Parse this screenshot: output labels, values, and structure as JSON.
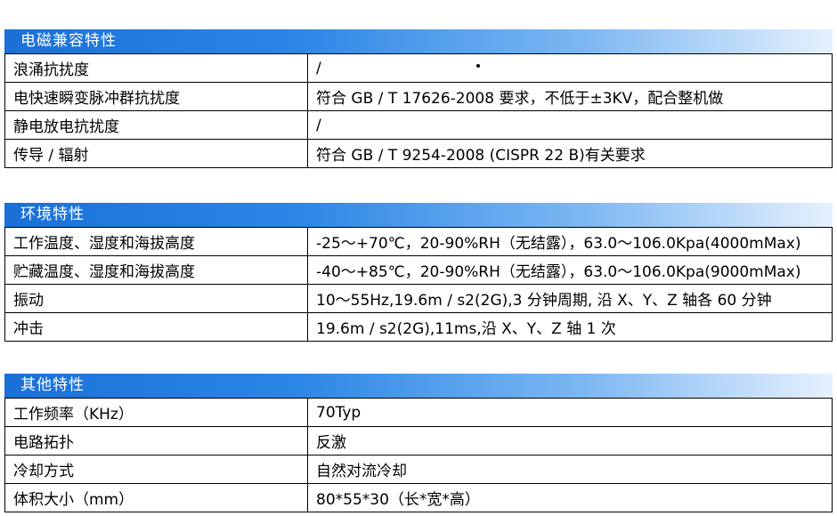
{
  "sections": [
    {
      "title": "电磁兼容特性",
      "rows": [
        {
          "label": "浪涌抗扰度",
          "value": "/"
        },
        {
          "label": "电快速瞬变脉冲群抗扰度",
          "value": "符合 GB / T 17626-2008 要求，不低于±3KV，配合整机做"
        },
        {
          "label": "静电放电抗扰度",
          "value": "/"
        },
        {
          "label": "传导 / 辐射",
          "value": "符合 GB / T 9254-2008 (CISPR 22 B)有关要求"
        }
      ]
    },
    {
      "title": "环境特性",
      "rows": [
        {
          "label": "工作温度、湿度和海拔高度",
          "value": "-25～+70℃，20-90%RH（无结露），63.0～106.0Kpa(4000mMax)"
        },
        {
          "label": "贮藏温度、湿度和海拔高度",
          "value": "-40～+85℃，20-90%RH（无结露），63.0～106.0Kpa(9000mMax)"
        },
        {
          "label": "振动",
          "value": "10～55Hz,19.6m / s2(2G),3 分钟周期, 沿 X、Y、Z 轴各 60 分钟"
        },
        {
          "label": "冲击",
          "value": "19.6m / s2(2G),11ms,沿 X、Y、Z 轴 1 次"
        }
      ]
    },
    {
      "title": "其他特性",
      "rows": [
        {
          "label": "工作频率（KHz）",
          "value": "70Typ"
        },
        {
          "label": "电路拓扑",
          "value": "反激"
        },
        {
          "label": "冷却方式",
          "value": "自然对流冷却"
        },
        {
          "label": "体积大小（mm）",
          "value": "80*55*30（长*宽*高）"
        }
      ]
    }
  ]
}
